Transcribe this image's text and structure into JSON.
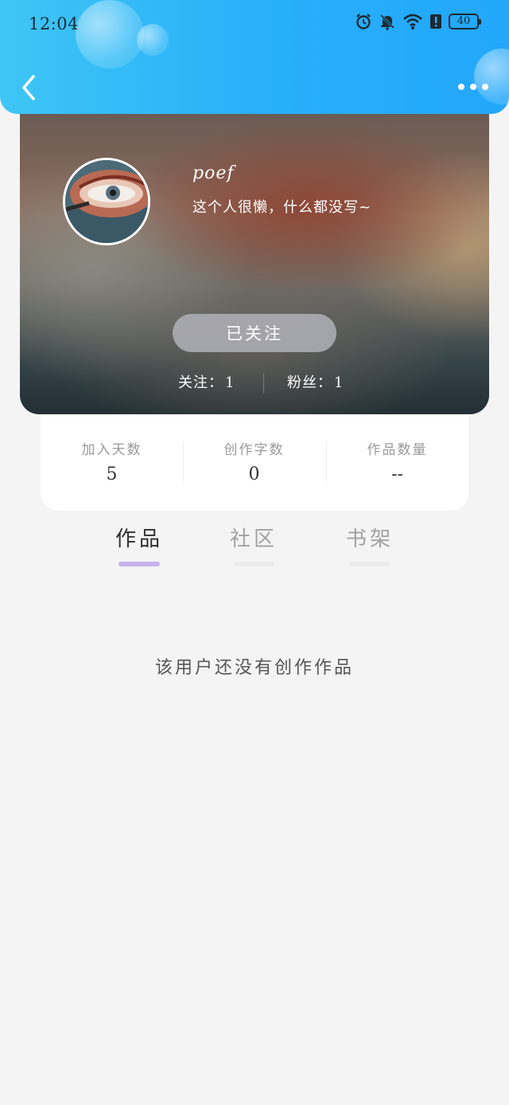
{
  "status_bar": {
    "time": "12:04",
    "battery": "40",
    "icons": [
      "alarm-icon",
      "bell-muted-icon",
      "wifi-icon",
      "alert-icon",
      "battery-icon"
    ]
  },
  "nav": {
    "back_icon": "chevron-left-icon",
    "more_icon": "more-horizontal-icon"
  },
  "profile": {
    "username": "poef",
    "bio": "这个人很懒，什么都没写~",
    "follow_button": "已关注",
    "following_label": "关注：",
    "following_count": "1",
    "fans_label": "粉丝：",
    "fans_count": "1"
  },
  "stats": [
    {
      "label": "加入天数",
      "value": "5"
    },
    {
      "label": "创作字数",
      "value": "0"
    },
    {
      "label": "作品数量",
      "value": "--"
    }
  ],
  "tabs": [
    {
      "label": "作品",
      "active": true
    },
    {
      "label": "社区",
      "active": false
    },
    {
      "label": "书架",
      "active": false
    }
  ],
  "empty_message": "该用户还没有创作作品",
  "colors": {
    "header_start": "#3ec6f5",
    "header_end": "#22a7fb",
    "tab_indicator_active": "#c6b2ec",
    "background": "#f4f4f4"
  }
}
